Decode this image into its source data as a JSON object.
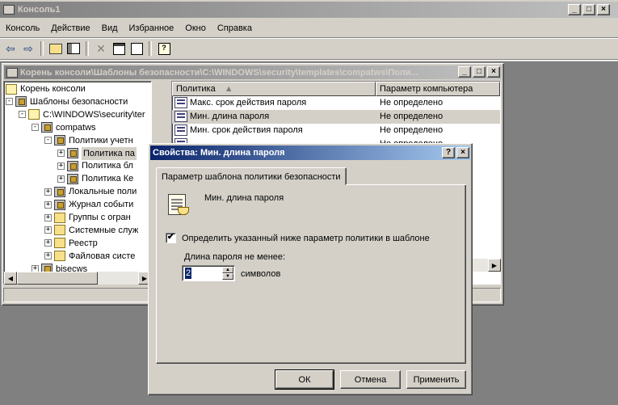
{
  "app": {
    "title": "Консоль1",
    "menu": [
      "Консоль",
      "Действие",
      "Вид",
      "Избранное",
      "Окно",
      "Справка"
    ],
    "window_buttons": [
      "_",
      "□",
      "×"
    ],
    "toolbar_icons": [
      "back-arrow-icon",
      "forward-arrow-icon",
      "up-folder-icon",
      "show-tree-icon",
      "delete-icon",
      "properties-icon",
      "export-list-icon",
      "help-icon"
    ]
  },
  "mdi": {
    "title": "Корень консоли\\Шаблоны безопасности\\C:\\WINDOWS\\security\\templates\\compatws\\Поли...",
    "tree": [
      {
        "label": "Корень консоли",
        "icon": "folder-open-icon",
        "toggle": ""
      },
      {
        "label": "Шаблоны безопасности",
        "icon": "security-templates-icon",
        "toggle": "-"
      },
      {
        "label": "C:\\WINDOWS\\security\\ter",
        "icon": "folder-open-icon",
        "toggle": "-"
      },
      {
        "label": "compatws",
        "icon": "template-icon",
        "toggle": "-"
      },
      {
        "label": "Политики учетн",
        "icon": "policy-folder-icon",
        "toggle": "-"
      },
      {
        "label": "Политика па",
        "icon": "policy-folder-icon",
        "toggle": "+"
      },
      {
        "label": "Политика бл",
        "icon": "policy-folder-icon",
        "toggle": "+"
      },
      {
        "label": "Политика Ке",
        "icon": "policy-folder-icon",
        "toggle": "+"
      },
      {
        "label": "Локальные поли",
        "icon": "policy-folder-icon",
        "toggle": "+"
      },
      {
        "label": "Журнал событи",
        "icon": "policy-folder-icon",
        "toggle": "+"
      },
      {
        "label": "Группы с огран",
        "icon": "folder-icon",
        "toggle": "+"
      },
      {
        "label": "Системные служ",
        "icon": "folder-icon",
        "toggle": "+"
      },
      {
        "label": "Реестр",
        "icon": "folder-icon",
        "toggle": "+"
      },
      {
        "label": "Файловая систе",
        "icon": "folder-icon",
        "toggle": "+"
      },
      {
        "label": "bisecws",
        "icon": "template-icon",
        "toggle": "+"
      }
    ],
    "list": {
      "columns": [
        "Политика",
        "Параметр компьютера"
      ],
      "rows": [
        {
          "policy": "Макс. срок действия пароля",
          "value": "Не определено"
        },
        {
          "policy": "Мин. длина пароля",
          "value": "Не определено"
        },
        {
          "policy": "Мин. срок действия пароля",
          "value": "Не определено"
        },
        {
          "policy": "",
          "value": "Не определено"
        },
        {
          "policy": "",
          "value": "Не определено"
        }
      ]
    }
  },
  "dialog": {
    "title": "Свойства: Мин. длина пароля",
    "tab": "Параметр шаблона политики безопасности",
    "policy_name": "Мин. длина пароля",
    "checkbox_label": "Определить указанный ниже параметр политики в шаблоне",
    "checkbox_checked": true,
    "field_label": "Длина пароля не менее:",
    "field_value": "2",
    "unit": "символов",
    "ok": "ОК",
    "cancel": "Отмена",
    "apply": "Применить",
    "title_buttons": [
      "?",
      "×"
    ]
  },
  "colors": {
    "active_title": "#0a246a",
    "inactive_title": "#808080",
    "face": "#d4d0c8",
    "desktop": "#808080"
  }
}
